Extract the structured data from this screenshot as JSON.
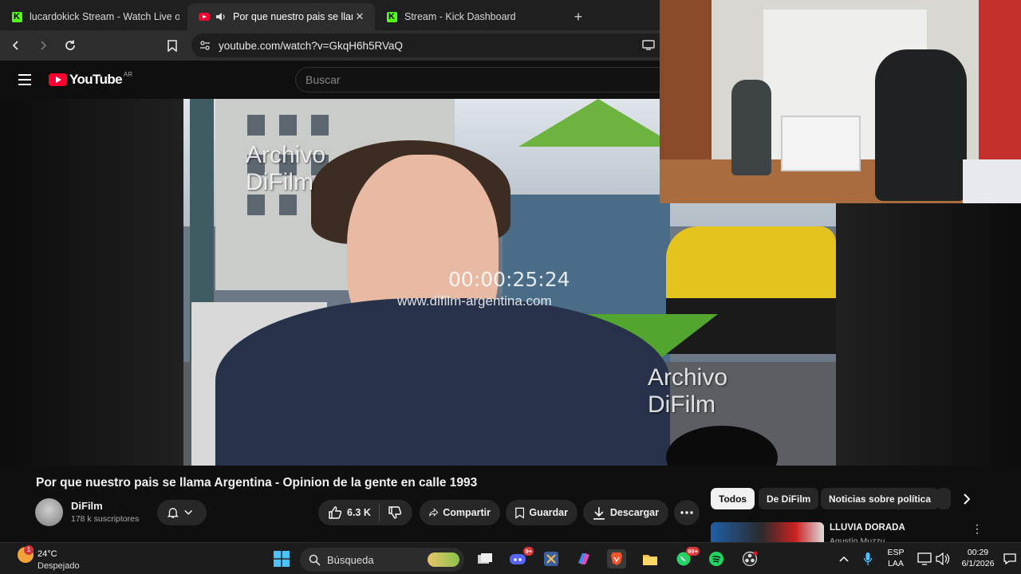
{
  "browser": {
    "tabs": [
      {
        "title": "lucardokick Stream - Watch Live on K",
        "icon": "kick-icon",
        "active": false
      },
      {
        "title": "Por que nuestro pais se llama",
        "icon": "youtube-icon",
        "active": true
      },
      {
        "title": "Stream - Kick Dashboard",
        "icon": "kick-icon",
        "active": false
      }
    ],
    "new_tab": "+",
    "url": "youtube.com/watch?v=GkqH6h5RVaQ"
  },
  "youtube": {
    "logo_text": "YouTube",
    "country": "AR",
    "search_placeholder": "Buscar"
  },
  "video": {
    "watermark_top": "Archivo\nDiFilm",
    "watermark_bottom": "Archivo\nDiFilm",
    "timecode": "00:00:25:24",
    "site": "www.difilm-argentina.com",
    "title": "Por que nuestro pais se llama Argentina - Opinion de la gente en calle 1993",
    "channel": "DiFilm",
    "subscribers": "178 k suscriptores",
    "likes": "6.3 K",
    "share": "Compartir",
    "save": "Guardar",
    "download": "Descargar"
  },
  "sidebar": {
    "chips": [
      "Todos",
      "De DiFilm",
      "Noticias sobre política"
    ],
    "suggestion": {
      "title": "LLUVIA DORADA",
      "author": "Agustín Muzzu"
    }
  },
  "taskbar": {
    "temperature": "24°C",
    "condition": "Despejado",
    "weather_badge": "1",
    "search": "Búsqueda",
    "discord_badge": "9+",
    "whatsapp_badge": "99+",
    "lang_top": "ESP",
    "lang_bottom": "LAA",
    "time": "00:29",
    "date": "6/1/2026"
  },
  "colors": {
    "youtube_red": "#ff0033",
    "kick_green": "#53fc18",
    "background": "#0f0f0f"
  }
}
